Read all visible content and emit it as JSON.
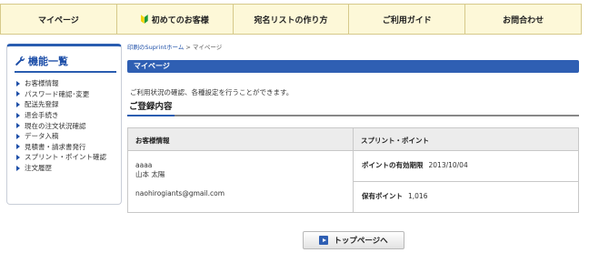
{
  "topnav": {
    "items": [
      {
        "label": "マイページ"
      },
      {
        "label": "初めてのお客様"
      },
      {
        "label": "宛名リストの作り方"
      },
      {
        "label": "ご利用ガイド"
      },
      {
        "label": "お問合わせ"
      }
    ]
  },
  "sidebar": {
    "title": "機能一覧",
    "items": [
      "お客様情報",
      "パスワード確認･変更",
      "配送先登録",
      "退会手続き",
      "現在の注文状況確認",
      "データ入稿",
      "見積書・請求書発行",
      "スプリント・ポイント確認",
      "注文履歴"
    ]
  },
  "breadcrumb": {
    "home": "印刷のSuprintホーム",
    "separator": " > ",
    "current": "マイページ"
  },
  "main": {
    "page_title": "マイページ",
    "intro": "ご利用状況の確認、各種設定を行うことができます。",
    "section_title": "ご登録内容",
    "customer": {
      "header": "お客様情報",
      "company": "aaaa",
      "name": "山本 太陽",
      "email": "naohirogiants@gmail.com"
    },
    "points": {
      "header": "スプリント・ポイント",
      "expiry_label": "ポイントの有効期限",
      "expiry_value": "2013/10/04",
      "held_label": "保有ポイント",
      "held_value": "1,016"
    },
    "top_button": "トップページへ"
  },
  "colors": {
    "accent": "#2f5fb3",
    "nav_bg": "#fdf8d8"
  }
}
